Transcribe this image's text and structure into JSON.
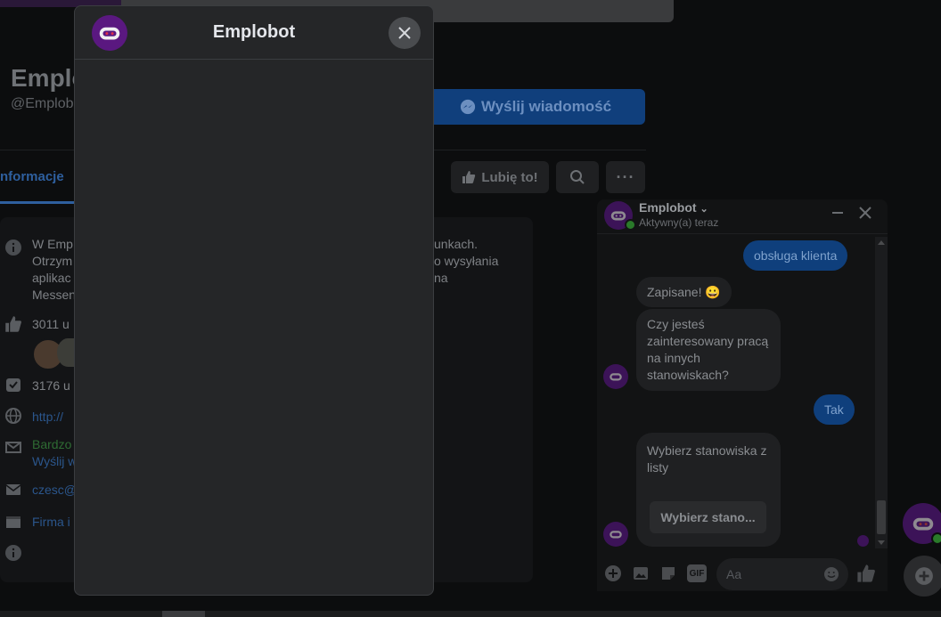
{
  "page": {
    "name": "Emplo",
    "handle": "@Emplob",
    "send_message_label": "Wyślij wiadomość",
    "tab_info": "nformacje",
    "like_label": "Lubię to!",
    "more_label": "···"
  },
  "info": {
    "about_lines": [
      "W Emp",
      "Otrzym",
      "aplikac",
      "Messen"
    ],
    "about_right_lines": [
      "unkach.",
      "o wysyłania",
      "na"
    ],
    "likes": "3011 u",
    "follows": "3176 u",
    "website": "http://",
    "response_line1": "Bardzo",
    "response_line2": "Wyślij w",
    "email": "czesc@",
    "category": "Firma i"
  },
  "modal": {
    "title": "Emplobot",
    "close_icon": "close-icon"
  },
  "chat": {
    "name": "Emplobot",
    "status": "Aktywny(a) teraz",
    "messages": {
      "out1": "obsługa klienta",
      "in1": "Zapisane! 😀",
      "in2": "Czy jesteś zainteresowany pracą na innych stanowiskach?",
      "out2": "Tak",
      "in3": "Wybierz stanowiska z listy",
      "in3_button": "Wybierz stano..."
    },
    "composer_placeholder": "Aa"
  },
  "colors": {
    "bot_purple": "#5a1880",
    "messenger_blue": "#0f3f7c"
  }
}
